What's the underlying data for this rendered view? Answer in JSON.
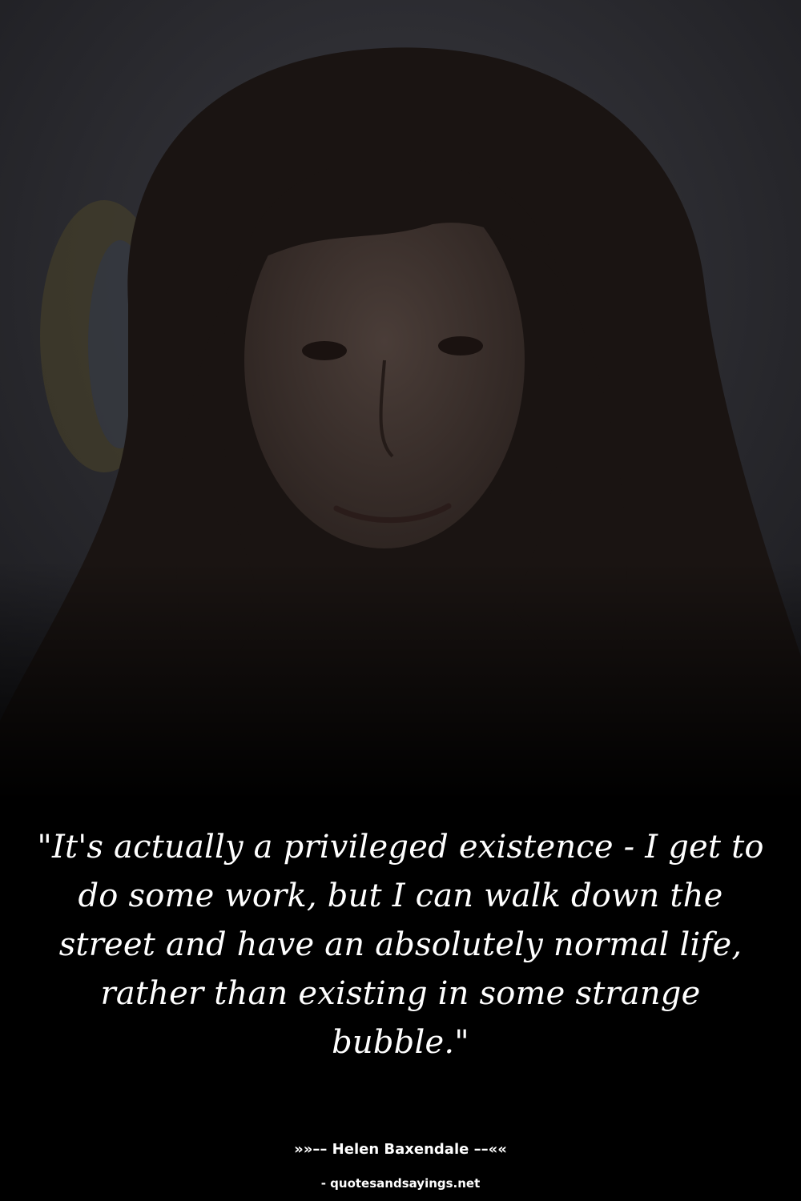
{
  "quote": {
    "text": "\"It's actually a privileged existence - I get to do some work, but I can walk down the street and have an absolutely normal life, rather than existing in some strange bubble.\""
  },
  "author": {
    "line": "»»–– Helen Baxendale ––««"
  },
  "source": {
    "line": "- quotesandsayings.net"
  },
  "photo": {
    "subject": "portrait of a woman with long dark hair, darkened background"
  },
  "colors": {
    "background": "#000000",
    "text": "#ffffff"
  }
}
